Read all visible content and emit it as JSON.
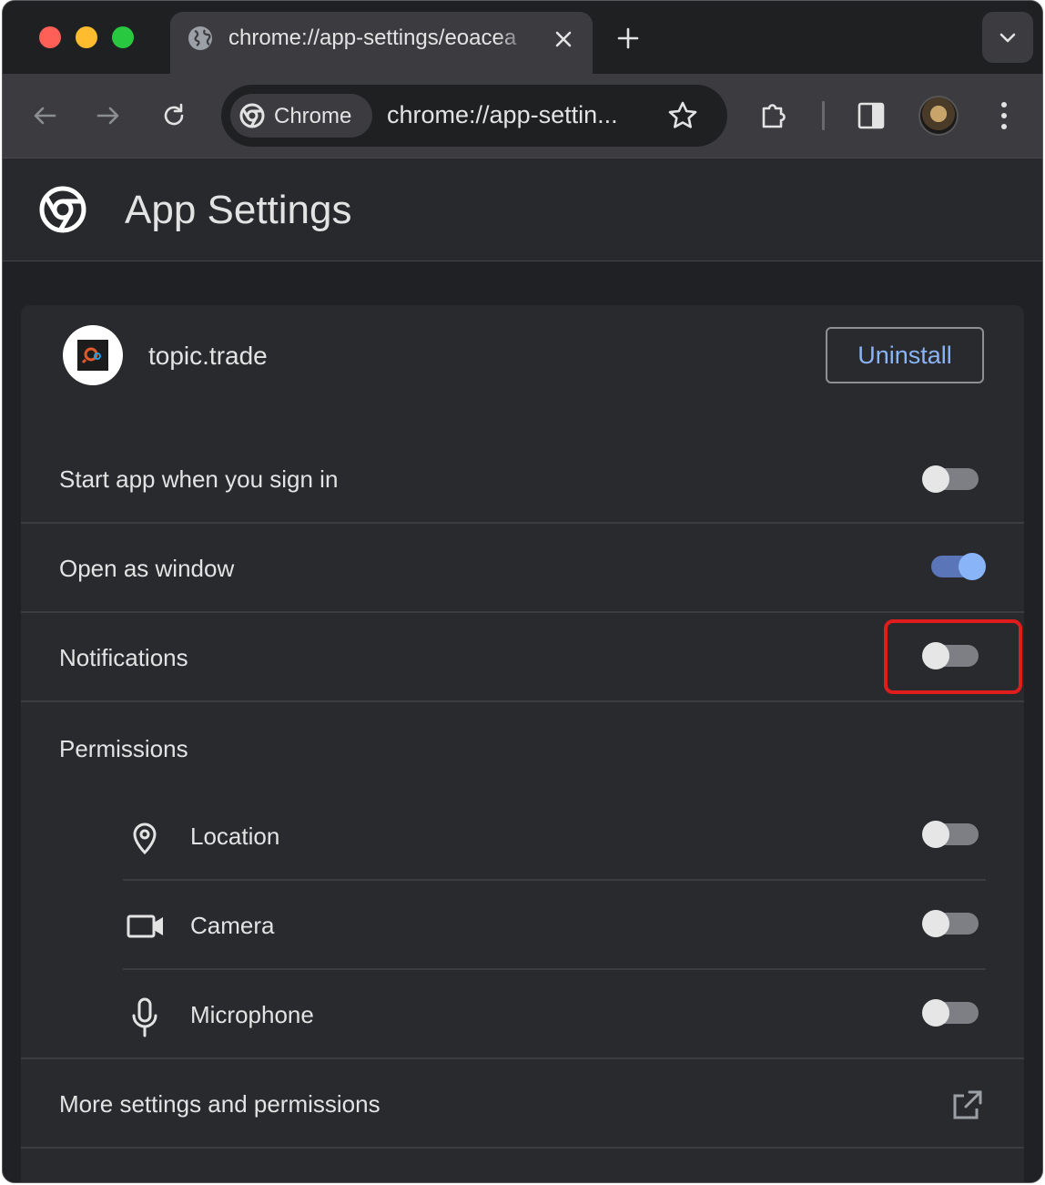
{
  "browser": {
    "tab_title": "chrome://app-settings/eoacea",
    "omnibox_chip": "Chrome",
    "omnibox_url": "chrome://app-settin..."
  },
  "page": {
    "title": "App Settings"
  },
  "app": {
    "name": "topic.trade",
    "uninstall_label": "Uninstall"
  },
  "settings": [
    {
      "label": "Start app when you sign in",
      "enabled": false
    },
    {
      "label": "Open as window",
      "enabled": true
    },
    {
      "label": "Notifications",
      "enabled": false
    }
  ],
  "permissions": {
    "title": "Permissions",
    "items": [
      {
        "label": "Location",
        "icon": "location-pin-icon",
        "enabled": false
      },
      {
        "label": "Camera",
        "icon": "camera-icon",
        "enabled": false
      },
      {
        "label": "Microphone",
        "icon": "microphone-icon",
        "enabled": false
      }
    ]
  },
  "more_settings": {
    "label": "More settings and permissions"
  },
  "colors": {
    "accent": "#8ab4f8",
    "highlight": "#e01c1c",
    "background": "#202124"
  }
}
